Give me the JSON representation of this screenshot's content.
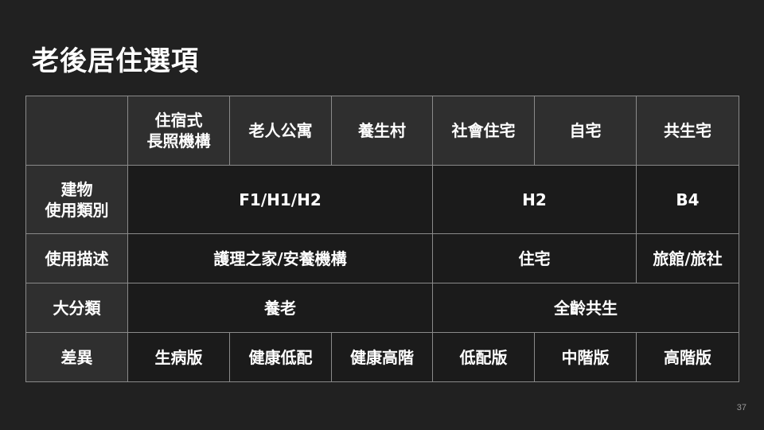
{
  "title": "老後居住選項",
  "page_number": "37",
  "table": {
    "header": {
      "corner": "",
      "columns": [
        {
          "line1": "住宿式",
          "line2": "長照機構"
        },
        {
          "line1": "老人公寓",
          "line2": ""
        },
        {
          "line1": "養生村",
          "line2": ""
        },
        {
          "line1": "社會住宅",
          "line2": ""
        },
        {
          "line1": "自宅",
          "line2": ""
        },
        {
          "line1": "共生宅",
          "line2": ""
        }
      ]
    },
    "building_use": {
      "label_line1": "建物",
      "label_line2": "使用類別",
      "values": [
        "F1/H1/H2",
        "H2",
        "B4"
      ]
    },
    "use_description": {
      "label": "使用描述",
      "values": [
        "護理之家/安養機構",
        "住宅",
        "旅館/旅社"
      ]
    },
    "major_category": {
      "label": "大分類",
      "values": [
        "養老",
        "全齡共生"
      ]
    },
    "difference": {
      "label": "差異",
      "values": [
        "生病版",
        "健康低配",
        "健康高階",
        "低配版",
        "中階版",
        "高階版"
      ]
    }
  }
}
